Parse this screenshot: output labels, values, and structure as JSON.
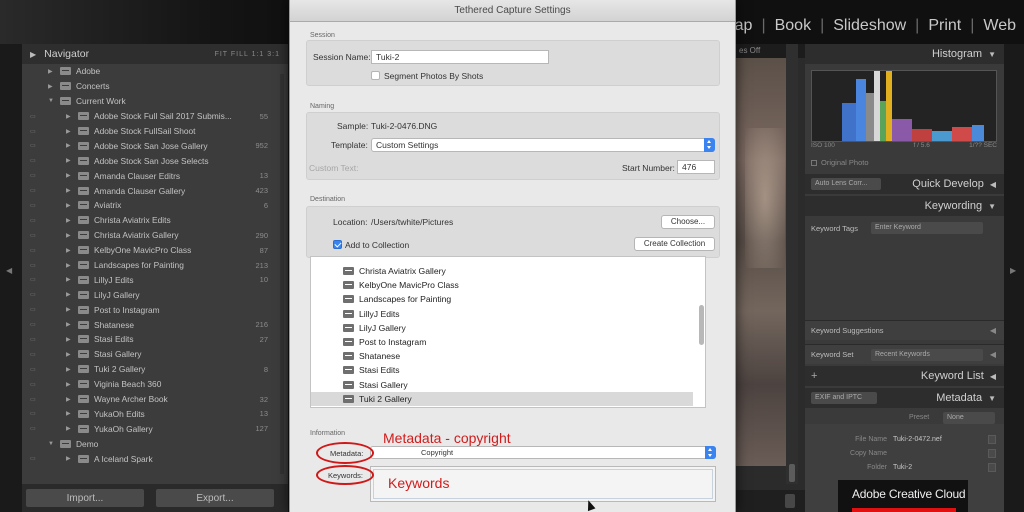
{
  "modules": [
    "Map",
    "Book",
    "Slideshow",
    "Print",
    "Web"
  ],
  "navigator": {
    "title": "Navigator",
    "zoom": "FIT  FILL  1:1  3:1"
  },
  "tree": [
    {
      "level": 1,
      "label": "Adobe",
      "count": ""
    },
    {
      "level": 1,
      "label": "Concerts",
      "count": ""
    },
    {
      "level": 1,
      "label": "Current Work",
      "count": "",
      "open": true
    },
    {
      "level": 2,
      "label": "Adobe Stock Full Sail 2017 Submis...",
      "count": "55"
    },
    {
      "level": 2,
      "label": "Adobe Stock FullSail Shoot",
      "count": ""
    },
    {
      "level": 2,
      "label": "Adobe Stock San Jose Gallery",
      "count": "952"
    },
    {
      "level": 2,
      "label": "Adobe Stock San Jose Selects",
      "count": ""
    },
    {
      "level": 2,
      "label": "Amanda Clauser Editrs",
      "count": "13"
    },
    {
      "level": 2,
      "label": "Amanda Clauser Gallery",
      "count": "423"
    },
    {
      "level": 2,
      "label": "Aviatrix",
      "count": "6"
    },
    {
      "level": 2,
      "label": "Christa Aviatrix Edits",
      "count": ""
    },
    {
      "level": 2,
      "label": "Christa Aviatrix Gallery",
      "count": "290"
    },
    {
      "level": 2,
      "label": "KelbyOne MavicPro Class",
      "count": "87"
    },
    {
      "level": 2,
      "label": "Landscapes for Painting",
      "count": "213"
    },
    {
      "level": 2,
      "label": "LillyJ Edits",
      "count": "10"
    },
    {
      "level": 2,
      "label": "LilyJ Gallery",
      "count": ""
    },
    {
      "level": 2,
      "label": "Post to Instagram",
      "count": ""
    },
    {
      "level": 2,
      "label": "Shatanese",
      "count": "216"
    },
    {
      "level": 2,
      "label": "Stasi Edits",
      "count": "27"
    },
    {
      "level": 2,
      "label": "Stasi Gallery",
      "count": ""
    },
    {
      "level": 2,
      "label": "Tuki 2 Gallery",
      "count": "8"
    },
    {
      "level": 2,
      "label": "Viginia Beach 360",
      "count": ""
    },
    {
      "level": 2,
      "label": "Wayne Archer Book",
      "count": "32"
    },
    {
      "level": 2,
      "label": "YukaOh Edits",
      "count": "13"
    },
    {
      "level": 2,
      "label": "YukaOh Gallery",
      "count": "127"
    },
    {
      "level": 1,
      "label": "Demo",
      "count": "",
      "open": true
    },
    {
      "level": 2,
      "label": "A Iceland Spark",
      "count": ""
    }
  ],
  "left_buttons": {
    "import": "Import...",
    "export": "Export..."
  },
  "center": {
    "toolbar_text": "es Off"
  },
  "right_panel": {
    "histogram": "Histogram",
    "histo_info": [
      "ISO 100",
      "",
      "f / 5.6",
      "1/?? SEC"
    ],
    "original_photo": "Original Photo",
    "quick_develop_select": "Auto Lens Corr...",
    "quick_develop": "Quick Develop",
    "keywording": "Keywording",
    "keyword_tags_label": "Keyword Tags",
    "keyword_tags_value": "Enter Keyword",
    "keyword_suggestions": "Keyword Suggestions",
    "keyword_set_label": "Keyword Set",
    "keyword_set_value": "Recent Keywords",
    "keyword_list": "Keyword List",
    "metadata_select": "EXIF and IPTC",
    "metadata": "Metadata",
    "preset_label": "Preset",
    "preset_value": "None",
    "fields": [
      {
        "k": "File Name",
        "v": "Tuki-2-0472.nef"
      },
      {
        "k": "Copy Name",
        "v": ""
      },
      {
        "k": "Folder",
        "v": "Tuki-2"
      }
    ]
  },
  "adobe_cc": "Adobe Creative Cloud",
  "dialog": {
    "title": "Tethered Capture Settings",
    "session": {
      "label": "Session",
      "name_label": "Session Name:",
      "name_value": "Tuki-2",
      "segment_label": "Segment Photos By Shots"
    },
    "naming": {
      "label": "Naming",
      "sample_label": "Sample:",
      "sample_value": "Tuki-2-0476.DNG",
      "template_label": "Template:",
      "template_value": "Custom Settings",
      "custom_text_label": "Custom Text:",
      "start_number_label": "Start Number:",
      "start_number_value": "476"
    },
    "destination": {
      "label": "Destination",
      "location_label": "Location:",
      "location_value": "/Users/twhite/Pictures",
      "choose_button": "Choose...",
      "add_to_collection": "Add to Collection",
      "create_collection": "Create Collection"
    },
    "collections": [
      {
        "label": "Christa Aviatrix Gallery",
        "selected": false
      },
      {
        "label": "KelbyOne MavicPro Class",
        "selected": false
      },
      {
        "label": "Landscapes for Painting",
        "selected": false
      },
      {
        "label": "LillyJ Edits",
        "selected": false
      },
      {
        "label": "LilyJ Gallery",
        "selected": false
      },
      {
        "label": "Post to Instagram",
        "selected": false
      },
      {
        "label": "Shatanese",
        "selected": false
      },
      {
        "label": "Stasi Edits",
        "selected": false
      },
      {
        "label": "Stasi Gallery",
        "selected": false
      },
      {
        "label": "Tuki 2 Gallery",
        "selected": true
      }
    ],
    "information": {
      "label": "Information",
      "metadata_label": "Metadata:",
      "metadata_value": "Copyright",
      "keywords_label": "Keywords:"
    }
  },
  "annotations": {
    "metadata_note": "Metadata - copyright",
    "keywords_note": "Keywords",
    "color": "#d11c1c"
  }
}
